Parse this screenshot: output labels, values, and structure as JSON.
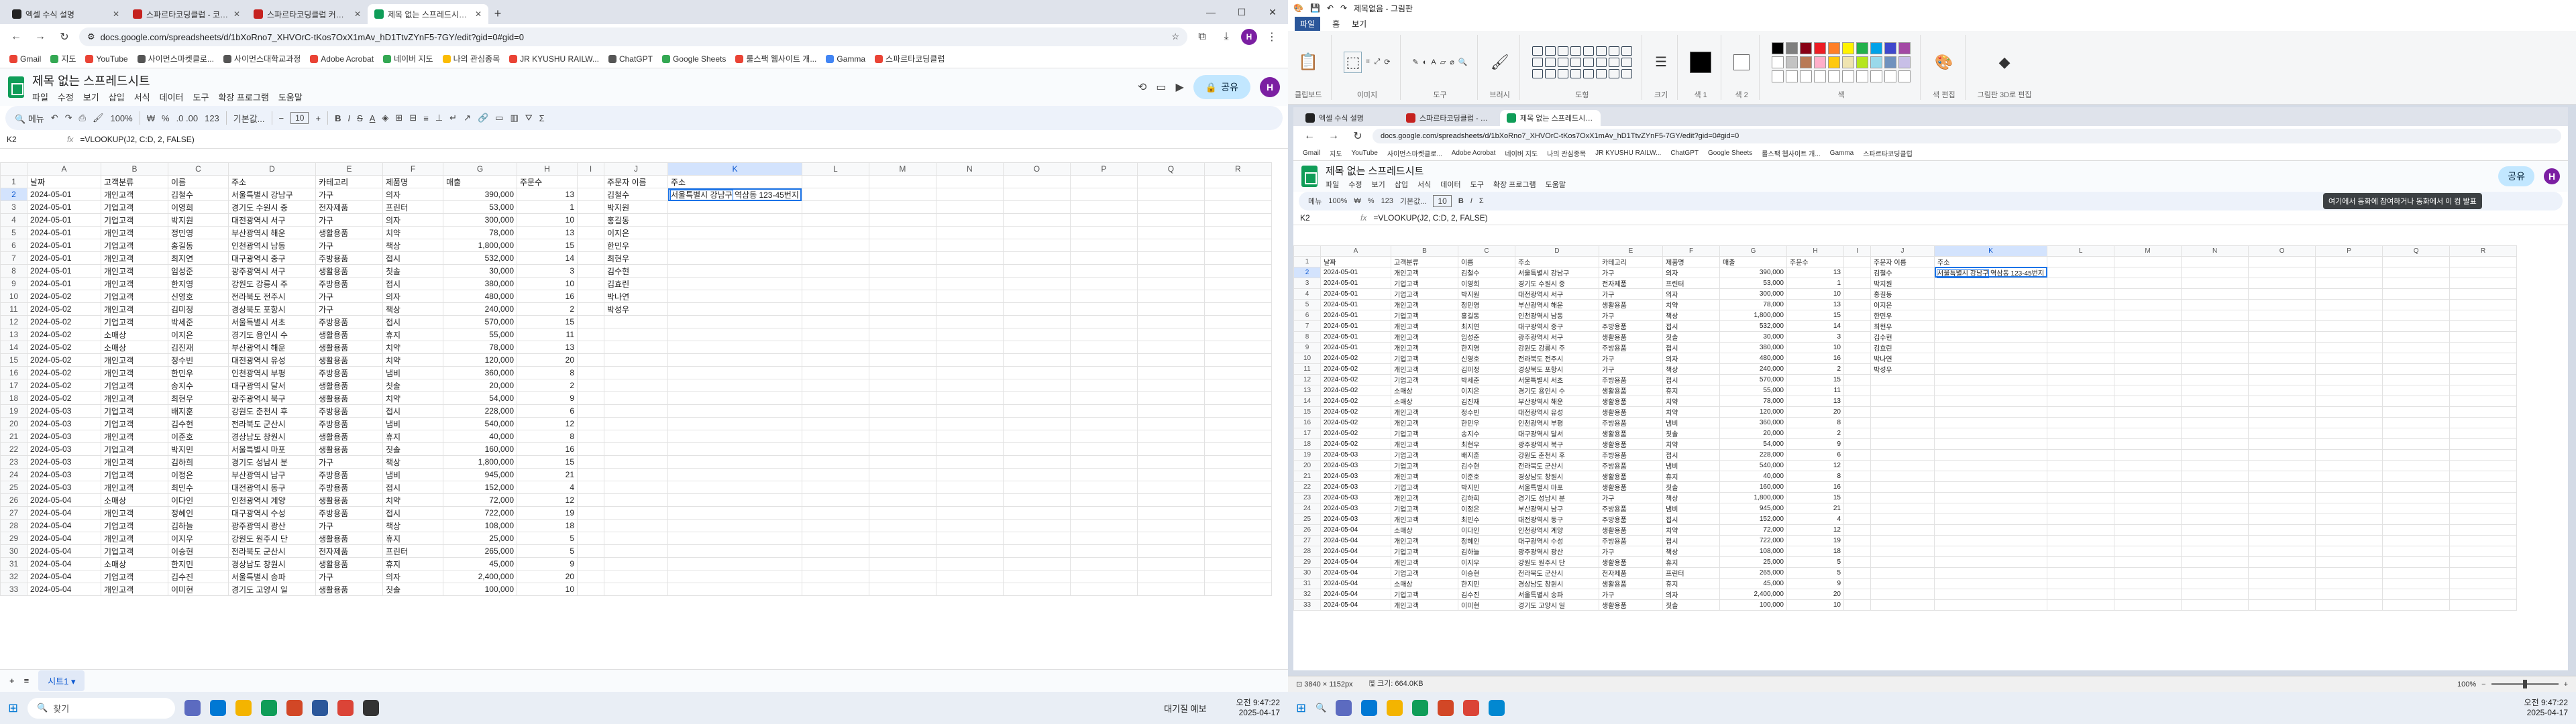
{
  "left": {
    "tabs": [
      {
        "label": "엑셀 수식 설명",
        "icon": "chatgpt-icon"
      },
      {
        "label": "스파르타코딩클럽 - 코딩, 5주",
        "icon": "spartacoding-icon"
      },
      {
        "label": "스파르타코딩클럽 커뮤니티 |",
        "icon": "spartacoding-icon"
      },
      {
        "label": "제목 없는 스프레드시트 - Goo",
        "icon": "sheets-icon"
      }
    ],
    "url": "docs.google.com/spreadsheets/d/1bXoRno7_XHVOrC-tKos7OxX1mAv_hD1TtvZYnF5-7GY/edit?gid=0#gid=0",
    "bookmarks": [
      "Gmail",
      "지도",
      "YouTube",
      "사이먼스마켓클로...",
      "사이먼스대학교과정",
      "Adobe Acrobat",
      "네이버 지도",
      "나의 관심종목",
      "JR KYUSHU RAILW...",
      "ChatGPT",
      "Google Sheets",
      "룰스팩 웹사이트 개...",
      "Gamma",
      "스파르타코딩클럽"
    ],
    "doc_title": "제목 없는 스프레드시트",
    "menus": [
      "파일",
      "수정",
      "보기",
      "삽입",
      "서식",
      "데이터",
      "도구",
      "확장 프로그램",
      "도움말"
    ],
    "share_label": "공유",
    "avatar": "H",
    "toolbar": {
      "menus": "메뉴",
      "zoom": "100%",
      "currency": "₩",
      "percent": "%",
      "decimals": ".0  .00",
      "numfmt": "123",
      "font": "기본값...",
      "font_size": "10"
    },
    "name_box": "K2",
    "formula": "=VLOOKUP(J2, C:D, 2, FALSE)",
    "sheet_tab": "시트1",
    "taskbar_search": "찾기",
    "weather": "대기질 예보",
    "clock_time": "오전 9:47:22",
    "clock_date": "2025-04-17"
  },
  "grid": {
    "columns": [
      "A",
      "B",
      "C",
      "D",
      "E",
      "F",
      "G",
      "H",
      "I",
      "J",
      "K",
      "L",
      "M",
      "N",
      "O",
      "P",
      "Q",
      "R"
    ],
    "header_row": [
      "날짜",
      "고객분류",
      "이름",
      "주소",
      "카테고리",
      "제품명",
      "매출",
      "주문수",
      "",
      "주문자 이름",
      "주소",
      "",
      "",
      "",
      "",
      "",
      "",
      ""
    ],
    "rows": [
      [
        "2024-05-01",
        "개인고객",
        "김철수",
        "서울특별시 강남구",
        "가구",
        "의자",
        "390,000",
        "13",
        "",
        "김철수",
        "서울특별시 강남구"
      ],
      [
        "2024-05-01",
        "기업고객",
        "이영희",
        "경기도 수원시 중",
        "전자제품",
        "프린터",
        "53,000",
        "1",
        "",
        "박지원",
        ""
      ],
      [
        "2024-05-01",
        "기업고객",
        "박지원",
        "대전광역시 서구",
        "가구",
        "의자",
        "300,000",
        "10",
        "",
        "홍길동",
        ""
      ],
      [
        "2024-05-01",
        "개인고객",
        "정민영",
        "부산광역시 해운",
        "생활용품",
        "치약",
        "78,000",
        "13",
        "",
        "이지은",
        ""
      ],
      [
        "2024-05-01",
        "기업고객",
        "홍길동",
        "인천광역시 남동",
        "가구",
        "책상",
        "1,800,000",
        "15",
        "",
        "한민우",
        ""
      ],
      [
        "2024-05-01",
        "개인고객",
        "최지연",
        "대구광역시 중구",
        "주방용품",
        "접시",
        "532,000",
        "14",
        "",
        "최현우",
        ""
      ],
      [
        "2024-05-01",
        "개인고객",
        "임성준",
        "광주광역시 서구",
        "생활용품",
        "칫솔",
        "30,000",
        "3",
        "",
        "김수현",
        ""
      ],
      [
        "2024-05-01",
        "개인고객",
        "한지영",
        "강원도 강릉시 주",
        "주방용품",
        "접시",
        "380,000",
        "10",
        "",
        "김효린",
        ""
      ],
      [
        "2024-05-02",
        "기업고객",
        "신영호",
        "전라북도 전주시",
        "가구",
        "의자",
        "480,000",
        "16",
        "",
        "박나연",
        ""
      ],
      [
        "2024-05-02",
        "개인고객",
        "김미정",
        "경상북도 포항시",
        "가구",
        "책상",
        "240,000",
        "2",
        "",
        "박성우",
        ""
      ],
      [
        "2024-05-02",
        "기업고객",
        "박세준",
        "서울특별시 서초",
        "주방용품",
        "접시",
        "570,000",
        "15",
        "",
        "",
        ""
      ],
      [
        "2024-05-02",
        "소매상",
        "이지은",
        "경기도 용인시 수",
        "생활용품",
        "휴지",
        "55,000",
        "11",
        "",
        "",
        ""
      ],
      [
        "2024-05-02",
        "소매상",
        "김진재",
        "부산광역시 해운",
        "생활용품",
        "치약",
        "78,000",
        "13",
        "",
        "",
        ""
      ],
      [
        "2024-05-02",
        "개인고객",
        "정수빈",
        "대전광역시 유성",
        "생활용품",
        "치약",
        "120,000",
        "20",
        "",
        "",
        ""
      ],
      [
        "2024-05-02",
        "개인고객",
        "한민우",
        "인천광역시 부평",
        "주방용품",
        "냄비",
        "360,000",
        "8",
        "",
        "",
        ""
      ],
      [
        "2024-05-02",
        "기업고객",
        "송지수",
        "대구광역시 달서",
        "생활용품",
        "칫솔",
        "20,000",
        "2",
        "",
        "",
        ""
      ],
      [
        "2024-05-02",
        "개인고객",
        "최현우",
        "광주광역시 북구",
        "생활용품",
        "치약",
        "54,000",
        "9",
        "",
        "",
        ""
      ],
      [
        "2024-05-03",
        "기업고객",
        "배지훈",
        "강원도 춘천시 후",
        "주방용품",
        "접시",
        "228,000",
        "6",
        "",
        "",
        ""
      ],
      [
        "2024-05-03",
        "기업고객",
        "김수현",
        "전라북도 군산시",
        "주방용품",
        "냄비",
        "540,000",
        "12",
        "",
        "",
        ""
      ],
      [
        "2024-05-03",
        "개인고객",
        "이준호",
        "경상남도 창원시",
        "생활용품",
        "휴지",
        "40,000",
        "8",
        "",
        "",
        ""
      ],
      [
        "2024-05-03",
        "기업고객",
        "박지민",
        "서울특별시 마포",
        "생활용품",
        "칫솔",
        "160,000",
        "16",
        "",
        "",
        ""
      ],
      [
        "2024-05-03",
        "개인고객",
        "김하희",
        "경기도 성남시 분",
        "가구",
        "책상",
        "1,800,000",
        "15",
        "",
        "",
        ""
      ],
      [
        "2024-05-03",
        "기업고객",
        "이정은",
        "부산광역시 남구",
        "주방용품",
        "냄비",
        "945,000",
        "21",
        "",
        "",
        ""
      ],
      [
        "2024-05-03",
        "개인고객",
        "최민수",
        "대전광역시 동구",
        "주방용품",
        "접시",
        "152,000",
        "4",
        "",
        "",
        ""
      ],
      [
        "2024-05-04",
        "소매상",
        "이다인",
        "인천광역시 계양",
        "생활용품",
        "치약",
        "72,000",
        "12",
        "",
        "",
        ""
      ],
      [
        "2024-05-04",
        "개인고객",
        "정혜인",
        "대구광역시 수성",
        "주방용품",
        "접시",
        "722,000",
        "19",
        "",
        "",
        ""
      ],
      [
        "2024-05-04",
        "기업고객",
        "김하늘",
        "광주광역시 광산",
        "가구",
        "책상",
        "108,000",
        "18",
        "",
        "",
        ""
      ],
      [
        "2024-05-04",
        "개인고객",
        "이지우",
        "강원도 원주시 단",
        "생활용품",
        "휴지",
        "25,000",
        "5",
        "",
        "",
        ""
      ],
      [
        "2024-05-04",
        "기업고객",
        "이승현",
        "전라북도 군산시",
        "전자제품",
        "프린터",
        "265,000",
        "5",
        "",
        "",
        ""
      ],
      [
        "2024-05-04",
        "소매상",
        "한지민",
        "경상남도 창원시",
        "생활용품",
        "휴지",
        "45,000",
        "9",
        "",
        "",
        ""
      ],
      [
        "2024-05-04",
        "기업고객",
        "김수진",
        "서울특별시 송파",
        "가구",
        "의자",
        "2,400,000",
        "20",
        "",
        "",
        ""
      ],
      [
        "2024-05-04",
        "개인고객",
        "이미현",
        "경기도 고양시 일",
        "생활용품",
        "칫솔",
        "100,000",
        "10",
        "",
        "",
        ""
      ]
    ],
    "selected_value": "서울특별시 강남구",
    "selected_suffix": " 역삼동 123-45번지"
  },
  "paint": {
    "title": "제목없음 - 그림판",
    "tabs": [
      "파일",
      "홈",
      "보기"
    ],
    "groups": [
      "클립보드",
      "이미지",
      "도구",
      "브러시",
      "도형",
      "크기",
      "색 1",
      "색 2",
      "색",
      "색 편집",
      "그림판 3D로 편집"
    ],
    "tooltip": "여기에서 동화에 참여하거나 동화에서 이 컴 발표",
    "status_size": "3840 × 1152px",
    "status_file": "크기: 664.0KB",
    "zoom": "100%",
    "clock_time": "오전 9:47:22",
    "clock_date": "2025-04-17"
  },
  "colors": {
    "accent": "#1a73e8",
    "share": "#c2e7ff",
    "sheets_green": "#0f9d58",
    "avatar": "#7b1fa2"
  }
}
